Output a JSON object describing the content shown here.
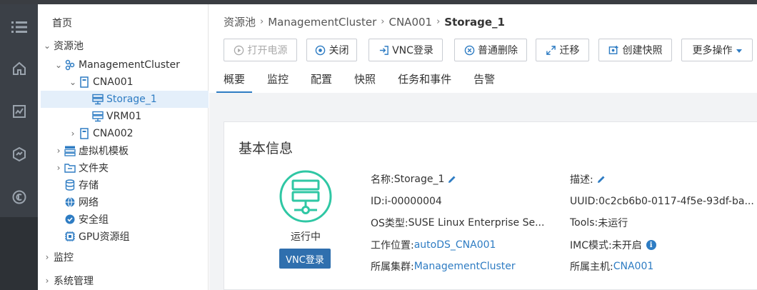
{
  "colors": {
    "accent": "#2e7cc3",
    "running": "#2fc7a4",
    "rail_bg": "#3b4047",
    "selected_bg": "#e4effa"
  },
  "rail": {
    "icons": [
      "menu-icon",
      "home-icon",
      "monitor-chart-icon",
      "network-icon",
      "copyright-circle-icon"
    ]
  },
  "tree": {
    "home": "首页",
    "resource_pool": "资源池",
    "cluster": "ManagementCluster",
    "cna001": "CNA001",
    "storage1": "Storage_1",
    "vrm01": "VRM01",
    "cna002": "CNA002",
    "vm_templates": "虚拟机模板",
    "folders": "文件夹",
    "storage": "存储",
    "network": "网络",
    "security_group": "安全组",
    "gpu_group": "GPU资源组",
    "monitor": "监控",
    "sys_mgmt": "系统管理"
  },
  "breadcrumb": {
    "item1": "资源池",
    "item2": "ManagementCluster",
    "item3": "CNA001",
    "current": "Storage_1",
    "sep": "›"
  },
  "toolbar": {
    "power_on": "打开电源",
    "shutdown": "关闭",
    "vnc_login": "VNC登录",
    "delete": "普通删除",
    "migrate": "迁移",
    "snapshot": "创建快照",
    "more": "更多操作"
  },
  "tabs": [
    "概要",
    "监控",
    "配置",
    "快照",
    "任务和事件",
    "告警"
  ],
  "basic_info": {
    "title": "基本信息",
    "status": "运行中",
    "vnc_button": "VNC登录",
    "name_label": "名称: ",
    "name_value": "Storage_1",
    "id_label": "ID: ",
    "id_value": "i-00000004",
    "os_label": "OS类型: ",
    "os_value": "SUSE Linux Enterprise Se...",
    "location_label": "工作位置: ",
    "location_value": "autoDS_CNA001",
    "cluster_label": "所属集群: ",
    "cluster_value": "ManagementCluster",
    "desc_label": "描述: ",
    "uuid_label": "UUID: ",
    "uuid_value": "0c2cb6b0-0117-4f5e-93df-ba...",
    "tools_label": "Tools: ",
    "tools_value": "未运行",
    "imc_label": "IMC模式: ",
    "imc_value": "未开启",
    "host_label": "所属主机: ",
    "host_value": "CNA001"
  }
}
